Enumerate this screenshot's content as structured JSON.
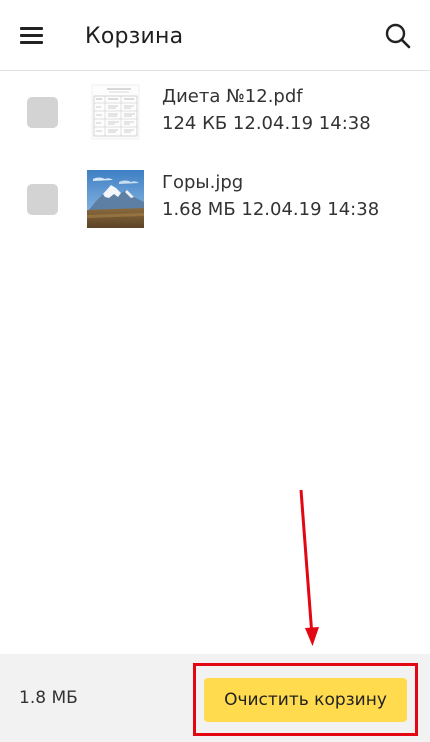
{
  "header": {
    "title": "Корзина",
    "menu_icon": "hamburger-menu-icon",
    "search_icon": "search-icon"
  },
  "files": [
    {
      "name": "Диета №12.pdf",
      "meta": "124 КБ 12.04.19 14:38",
      "thumbnail": "pdf-document-thumbnail"
    },
    {
      "name": "Горы.jpg",
      "meta": "1.68 МБ 12.04.19 14:38",
      "thumbnail": "mountain-photo-thumbnail"
    }
  ],
  "footer": {
    "total_size": "1.8 МБ",
    "clear_button_label": "Очистить корзину"
  },
  "colors": {
    "accent_button": "#ffdb4d",
    "annotation_red": "#e30613",
    "checkbox": "#d3d3d3",
    "footer_bg": "#f2f2f2"
  }
}
